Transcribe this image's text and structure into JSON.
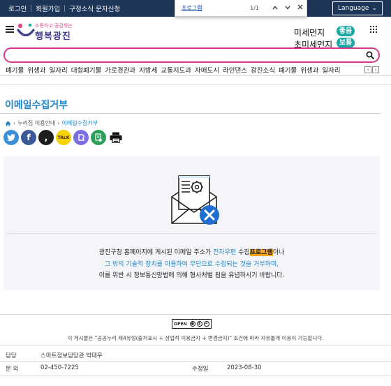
{
  "topbar": {
    "links": [
      "로그인",
      "회원가입",
      "구정소식 문자신청"
    ],
    "language": "Language"
  },
  "findbar": {
    "query": "프로그램",
    "count": "1/1",
    "up": "⌃",
    "down": "⌄",
    "close": "✕"
  },
  "header": {
    "logo_slogan": "소통하고 공감하는",
    "logo_name": "행복광진",
    "dust_label": "미세먼지",
    "dust_status": "좋음",
    "ultra_dust_label": "초미세먼지",
    "ultra_dust_status": "보통",
    "colors": {
      "accent": "#d6378b",
      "brand": "#1d3557",
      "link": "#1f86c8",
      "good": "#16a9a3"
    }
  },
  "search": {
    "placeholder": "",
    "value": ""
  },
  "keywords": [
    "폐기물",
    "위생과",
    "일자리",
    "대형폐기물",
    "가로경관과",
    "지방세",
    "교통지도과",
    "자매도시",
    "라인댄스",
    "광진소식",
    "폐기물",
    "위생과",
    "일자리"
  ],
  "page": {
    "title": "이메일수집거부",
    "breadcrumb": [
      "누리집 이용안내",
      "이메일수집거부"
    ]
  },
  "share_icons": [
    "twitter-icon",
    "facebook-icon",
    "kakaostory-icon",
    "kakaotalk-icon",
    "band-icon",
    "copy-url-icon",
    "print-icon"
  ],
  "notice": {
    "line1_a": "광진구청 홈페이지에 게시된 이메일 주소가 ",
    "line1_b": "전자우편",
    "line1_c": " 수집",
    "line1_d": "프로그램",
    "line1_e": "이나",
    "line2": "그 밖의 기술적 장치를 이용하여 무단으로 수집되는 것을 거부하며,",
    "line3": "이를 위반 시 정보통신망법에 의해 형사처벌 됨을 유념하시기 바랍니다."
  },
  "footer": {
    "license_badge": "OPEN",
    "license_note": "이 게시물은 \"공공누리 제4유형(출처표시 + 상업적 이용금지 + 변경금지)\" 조건에 따라 자유롭게 이용이 가능합니다.",
    "dept_label": "담당",
    "dept_value": "스마트정보담당관 박태우",
    "contact_label": "문 의",
    "contact_value": "02-450-7225",
    "modified_label": "수정일",
    "modified_value": "2023-08-30"
  }
}
